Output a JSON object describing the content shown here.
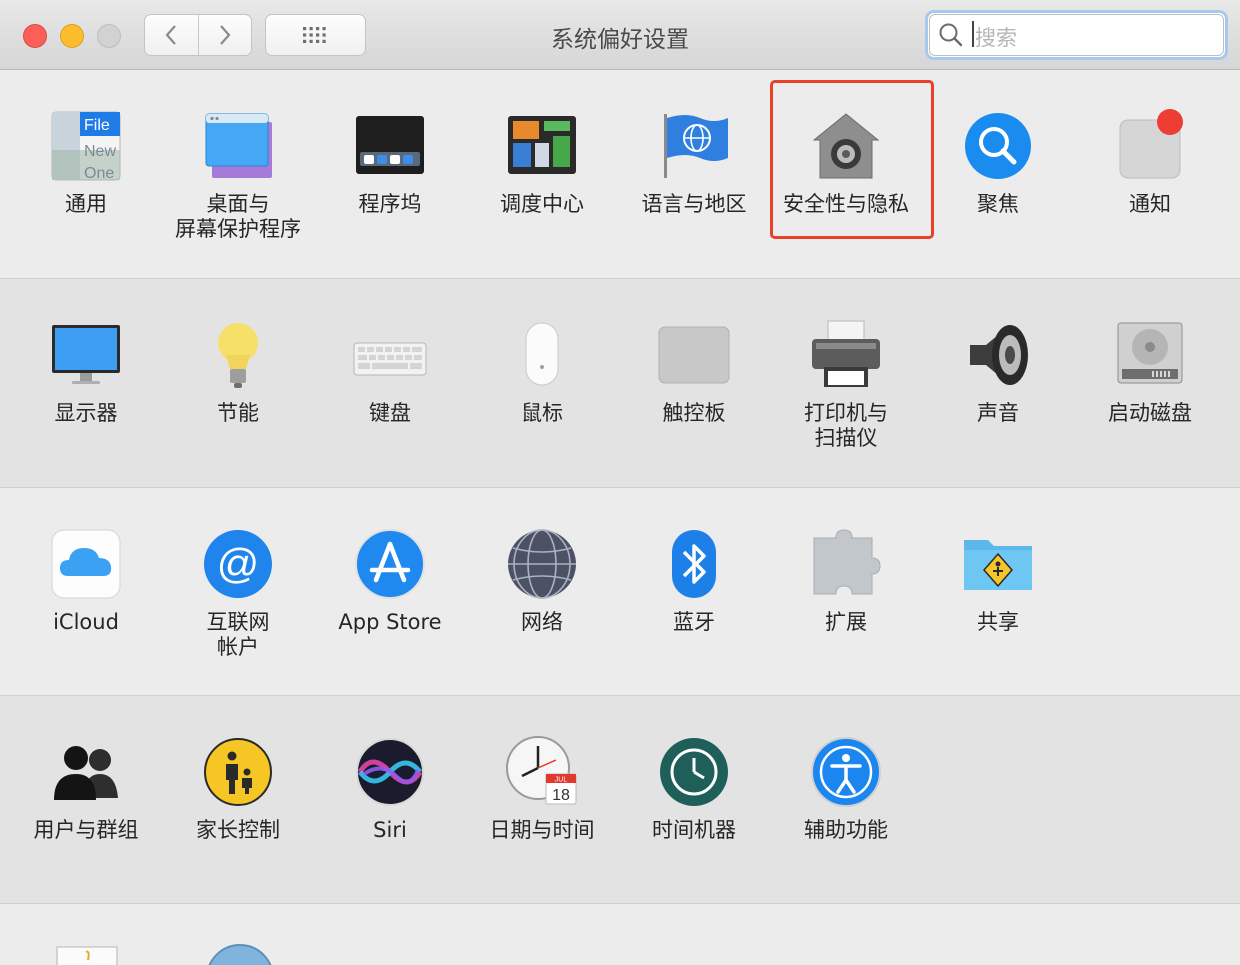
{
  "window": {
    "title": "系统偏好设置"
  },
  "search": {
    "placeholder": "搜索"
  },
  "rows": [
    [
      {
        "label": "通用",
        "icon": "general-icon"
      },
      {
        "label": "桌面与\n屏幕保护程序",
        "icon": "desktop-screensaver-icon"
      },
      {
        "label": "程序坞",
        "icon": "dock-icon"
      },
      {
        "label": "调度中心",
        "icon": "mission-control-icon"
      },
      {
        "label": "语言与地区",
        "icon": "language-region-icon"
      },
      {
        "label": "安全性与隐私",
        "icon": "security-privacy-icon"
      },
      {
        "label": "聚焦",
        "icon": "spotlight-icon"
      },
      {
        "label": "通知",
        "icon": "notifications-icon"
      }
    ],
    [
      {
        "label": "显示器",
        "icon": "display-icon"
      },
      {
        "label": "节能",
        "icon": "energy-saver-icon"
      },
      {
        "label": "键盘",
        "icon": "keyboard-icon"
      },
      {
        "label": "鼠标",
        "icon": "mouse-icon"
      },
      {
        "label": "触控板",
        "icon": "trackpad-icon"
      },
      {
        "label": "打印机与\n扫描仪",
        "icon": "printer-scanner-icon"
      },
      {
        "label": "声音",
        "icon": "sound-icon"
      },
      {
        "label": "启动磁盘",
        "icon": "startup-disk-icon"
      }
    ],
    [
      {
        "label": "iCloud",
        "icon": "icloud-icon"
      },
      {
        "label": "互联网\n帐户",
        "icon": "internet-accounts-icon"
      },
      {
        "label": "App Store",
        "icon": "app-store-icon"
      },
      {
        "label": "网络",
        "icon": "network-icon"
      },
      {
        "label": "蓝牙",
        "icon": "bluetooth-icon"
      },
      {
        "label": "扩展",
        "icon": "extensions-icon"
      },
      {
        "label": "共享",
        "icon": "sharing-icon"
      }
    ],
    [
      {
        "label": "用户与群组",
        "icon": "users-groups-icon"
      },
      {
        "label": "家长控制",
        "icon": "parental-controls-icon"
      },
      {
        "label": "Siri",
        "icon": "siri-icon"
      },
      {
        "label": "日期与时间",
        "icon": "date-time-icon"
      },
      {
        "label": "时间机器",
        "icon": "time-machine-icon"
      },
      {
        "label": "辅助功能",
        "icon": "accessibility-icon"
      }
    ]
  ],
  "date_icon": {
    "month": "JUL",
    "day": "18"
  },
  "colors": {
    "highlight": "#e8412b",
    "close": "#fc5f57",
    "minimize": "#fdbc2e",
    "accent": "#1b7ff0"
  }
}
